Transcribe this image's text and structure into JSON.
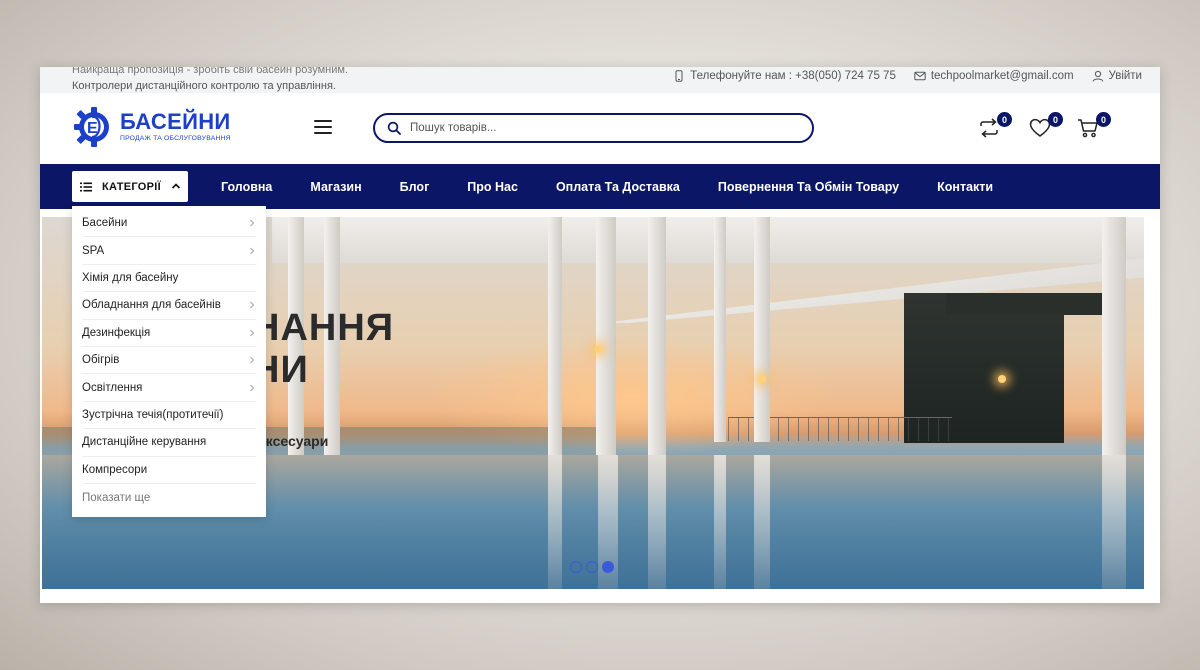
{
  "topbar": {
    "promo_line1": "Найкраща пропозиція - зробіть свій басейн розумним.",
    "promo_line2": "Контролери дистанційного контролю та управління.",
    "phone": "Телефонуйте нам : +38(050) 724 75 75",
    "email": "techpoolmarket@gmail.com",
    "login": "Увійти"
  },
  "logo": {
    "title": "БАСЕЙНИ",
    "subtitle": "ПРОДАЖ ТА ОБСЛУГОВУВАННЯ",
    "brand_color": "#1e40c8"
  },
  "search": {
    "placeholder": "Пошук товарів..."
  },
  "header_icons": {
    "compare_count": "0",
    "wishlist_count": "0",
    "cart_count": "0"
  },
  "nav": {
    "bg_color": "#0b1666",
    "categories_label": "КАТЕГОРІЇ",
    "links": [
      "Головна",
      "Магазин",
      "Блог",
      "Про Нас",
      "Оплата Та Доставка",
      "Повернення Та Обмін Товару",
      "Контакти"
    ]
  },
  "categories": {
    "items": [
      {
        "label": "Басейни",
        "has_sub": true
      },
      {
        "label": "SPA",
        "has_sub": true
      },
      {
        "label": "Хімія для басейну",
        "has_sub": false
      },
      {
        "label": "Обладнання для басейнів",
        "has_sub": true
      },
      {
        "label": "Дезинфекція",
        "has_sub": true
      },
      {
        "label": "Обігрів",
        "has_sub": true
      },
      {
        "label": "Освітлення",
        "has_sub": true
      },
      {
        "label": "Зустрічна течія(протитечії)",
        "has_sub": false
      },
      {
        "label": "Дистанційне керування",
        "has_sub": false
      },
      {
        "label": "Компресори",
        "has_sub": false
      }
    ],
    "show_more": "Показати ще"
  },
  "hero": {
    "title_line1": "НАННЯ",
    "title_line2": "НИ",
    "subtitle": "аксесуари",
    "slides": 3,
    "active_slide": 3
  }
}
